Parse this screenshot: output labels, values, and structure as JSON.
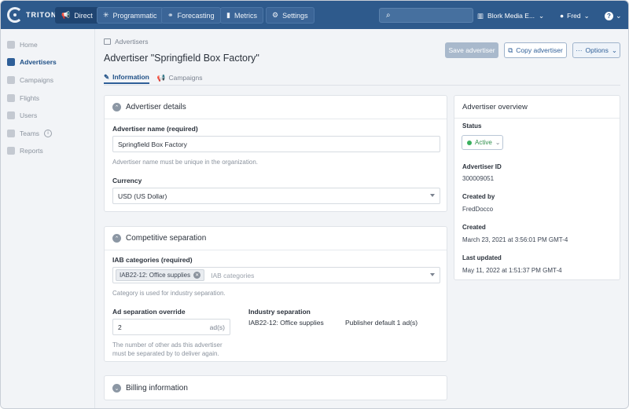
{
  "topbar": {
    "logo_text": "TRITON",
    "nav": [
      {
        "label": "Direct",
        "icon": "megaphone-icon"
      },
      {
        "label": "Programmatic",
        "icon": "asterisk-icon"
      },
      {
        "label": "Forecasting",
        "icon": "binoculars-icon"
      },
      {
        "label": "Metrics",
        "icon": "bar-chart-icon"
      },
      {
        "label": "Settings",
        "icon": "gear-icon"
      }
    ],
    "search_placeholder": "",
    "org": "Blork Media E...",
    "user": "Fred",
    "help_glyph": "?"
  },
  "sidebar": {
    "items": [
      {
        "label": "Home"
      },
      {
        "label": "Advertisers"
      },
      {
        "label": "Campaigns"
      },
      {
        "label": "Flights"
      },
      {
        "label": "Users"
      },
      {
        "label": "Teams"
      },
      {
        "label": "Reports"
      }
    ]
  },
  "header": {
    "breadcrumb": "Advertisers",
    "title": "Advertiser \"Springfield Box Factory\"",
    "tabs": [
      {
        "label": "Information"
      },
      {
        "label": "Campaigns"
      }
    ],
    "buttons": {
      "save": "Save advertiser",
      "copy": "Copy advertiser",
      "options": "Options"
    }
  },
  "advertiser_details": {
    "heading": "Advertiser details",
    "name_label": "Advertiser name (required)",
    "name_value": "Springfield Box Factory",
    "name_help": "Advertiser name must be unique in the organization.",
    "currency_label": "Currency",
    "currency_value": "USD (US Dollar)"
  },
  "competitive_separation": {
    "heading": "Competitive separation",
    "iab_label": "IAB categories (required)",
    "iab_chip": "IAB22-12: Office supplies",
    "iab_placeholder": "IAB categories",
    "iab_help": "Category is used for industry separation.",
    "override_label": "Ad separation override",
    "override_value": "2",
    "override_suffix": "ad(s)",
    "override_help_1": "The number of other ads this advertiser",
    "override_help_2": "must be separated by to deliver again.",
    "industry_label": "Industry separation",
    "industry_value": "IAB22-12: Office supplies",
    "publisher_default": "Publisher default 1 ad(s)"
  },
  "billing": {
    "heading": "Billing information"
  },
  "overview": {
    "heading": "Advertiser overview",
    "status_label": "Status",
    "status_value": "Active",
    "id_label": "Advertiser ID",
    "id_value": "300009051",
    "created_by_label": "Created by",
    "created_by_value": "FredDocco",
    "created_label": "Created",
    "created_value": "March 23, 2021 at 3:56:01 PM GMT-4",
    "updated_label": "Last updated",
    "updated_value": "May 11, 2022 at 1:51:37 PM GMT-4"
  },
  "colors": {
    "topbar": "#2e5a8c",
    "accent": "#2f5f98",
    "active_status": "#39b05e"
  }
}
